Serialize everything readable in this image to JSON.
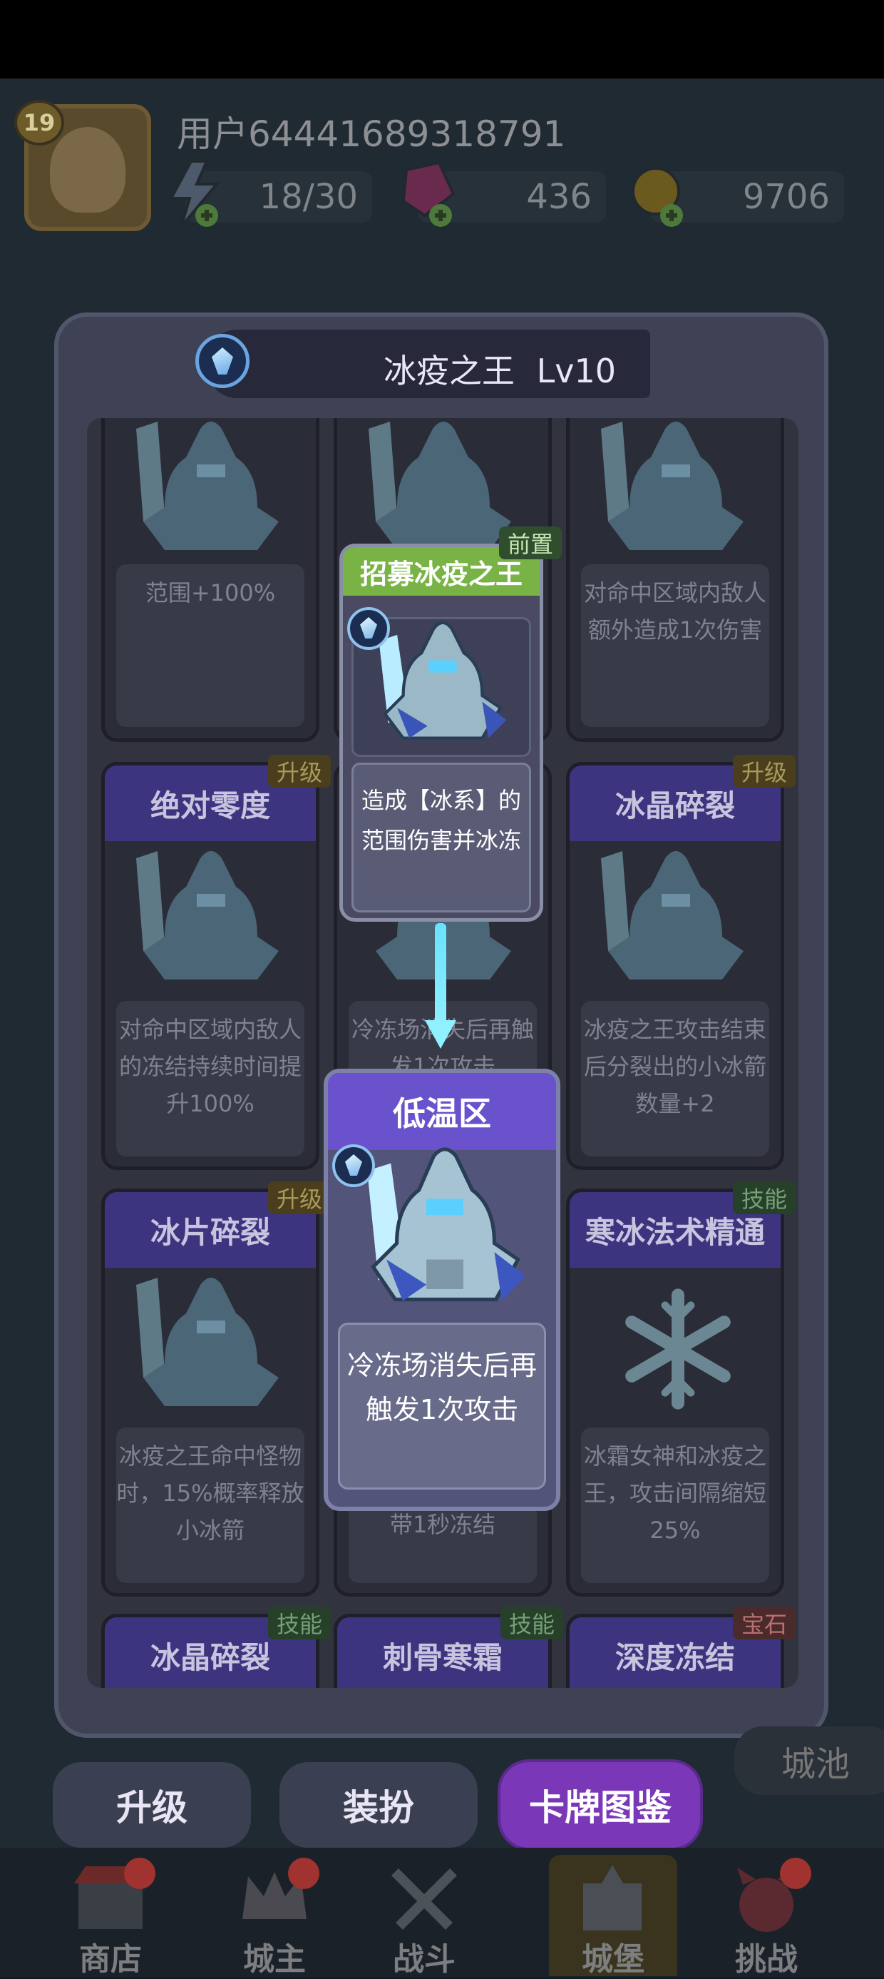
{
  "header": {
    "level": "19",
    "username": "用户64441689318791",
    "energy": "18/30",
    "gems": "436",
    "gold": "9706"
  },
  "modal": {
    "title": "冰疫之王",
    "level": "Lv10"
  },
  "cards": [
    {
      "title": "",
      "desc": "范围+100%",
      "badge": ""
    },
    {
      "title": "",
      "desc": "",
      "badge": ""
    },
    {
      "title": "",
      "desc": "对命中区域内敌人额外造成1次伤害",
      "badge": ""
    },
    {
      "title": "绝对零度",
      "desc": "对命中区域内敌人的冻结持续时间提升100%",
      "badge": "升级"
    },
    {
      "title": "",
      "desc": "冷冻场消失后再触发1次攻击",
      "badge": ""
    },
    {
      "title": "冰晶碎裂",
      "desc": "冰疫之王攻击结束后分裂出的小冰箭数量+2",
      "badge": "升级"
    },
    {
      "title": "冰片碎裂",
      "desc": "冰疫之王命中怪物时，15%概率释放小冰箭",
      "badge": "升级"
    },
    {
      "title": "",
      "desc": "带1秒冻结",
      "badge": ""
    },
    {
      "title": "寒冰法术精通",
      "desc": "冰霜女神和冰疫之王，攻击间隔缩短25%",
      "badge": "技能"
    },
    {
      "title": "冰晶碎裂",
      "desc": "",
      "badge": "技能"
    },
    {
      "title": "刺骨寒霜",
      "desc": "",
      "badge": "技能"
    },
    {
      "title": "深度冻结",
      "desc": "",
      "badge": "宝石"
    }
  ],
  "popup_pre": {
    "badge": "前置",
    "title": "招募冰疫之王",
    "desc": "造成【冰系】的范围伤害并冰冻"
  },
  "popup_main": {
    "title": "低温区",
    "desc": "冷冻场消失后再触发1次攻击"
  },
  "tabs": {
    "upgrade": "升级",
    "dress": "装扮",
    "cards": "卡牌图鉴",
    "city": "城池"
  },
  "nav": {
    "shop": "商店",
    "lord": "城主",
    "battle": "战斗",
    "castle": "城堡",
    "challenge": "挑战"
  }
}
